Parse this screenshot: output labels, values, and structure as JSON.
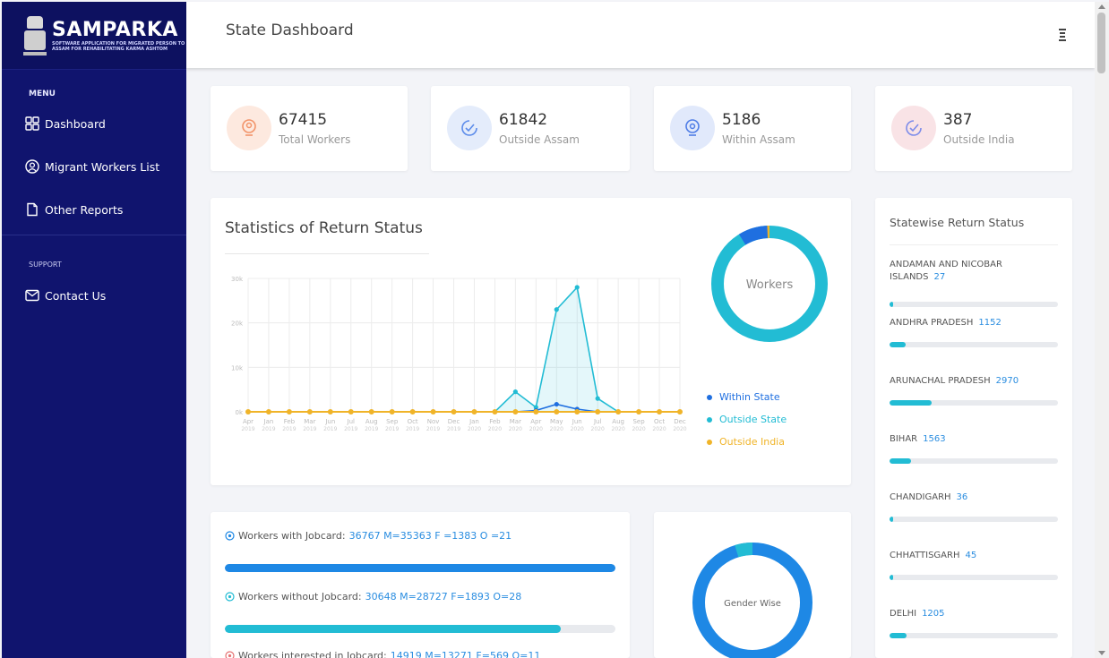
{
  "sidebar": {
    "brand_name": "SAMPARKA",
    "brand_sub": "SOFTWARE APPLICATION FOR MIGRATED PERSON TO ASSAM FOR REHABILITATING KARMA ASHTOM",
    "menu_heading": "MENU",
    "items": [
      {
        "label": "Dashboard",
        "icon": "dashboard-grid-icon"
      },
      {
        "label": "Migrant Workers List",
        "icon": "person-circle-icon"
      },
      {
        "label": "Other Reports",
        "icon": "document-icon"
      }
    ],
    "support_heading": "SUPPORT",
    "support_items": [
      {
        "label": "Contact Us",
        "icon": "mail-icon"
      }
    ]
  },
  "header": {
    "title": "State Dashboard"
  },
  "stats": [
    {
      "value": "67415",
      "label": "Total Workers",
      "icon": "person-pin-icon",
      "bg": "#fde9df",
      "fg": "#f2946a"
    },
    {
      "value": "61842",
      "label": "Outside Assam",
      "icon": "check-shield-icon",
      "bg": "#e4ecfb",
      "fg": "#5b8bea"
    },
    {
      "value": "5186",
      "label": "Within Assam",
      "icon": "location-pin-icon",
      "bg": "#e1e9fb",
      "fg": "#4f7de6"
    },
    {
      "value": "387",
      "label": "Outside India",
      "icon": "check-shield-icon",
      "bg": "#f9e3e6",
      "fg": "#7c8bea"
    }
  ],
  "return_status": {
    "title": "Statistics of Return Status",
    "donut_label": "Workers",
    "legend": [
      {
        "label": "Within State",
        "color": "#1f6fe0"
      },
      {
        "label": "Outside State",
        "color": "#22bcd4"
      },
      {
        "label": "Outside India",
        "color": "#f0b429"
      }
    ]
  },
  "chart_data": {
    "type": "line",
    "y_ticks": [
      "30k",
      "20k",
      "10k",
      "0k"
    ],
    "ylim": [
      0,
      30000
    ],
    "x": [
      "Apr 2019",
      "Jan 2019",
      "Feb 2019",
      "Mar 2019",
      "Jun 2019",
      "Jul 2019",
      "Aug 2019",
      "Sep 2019",
      "Oct 2019",
      "Nov 2019",
      "Dec 2019",
      "Jan 2020",
      "Feb 2020",
      "Mar 2020",
      "Apr 2020",
      "May 2020",
      "Jun 2020",
      "Jul 2020",
      "Aug 2020",
      "Sep 2020",
      "Oct 2020",
      "Dec 2020"
    ],
    "series": [
      {
        "name": "Within State",
        "color": "#1f6fe0",
        "values": [
          0,
          0,
          0,
          0,
          0,
          0,
          0,
          0,
          0,
          0,
          0,
          0,
          0,
          0,
          300,
          1700,
          600,
          0,
          0,
          0,
          0,
          0
        ]
      },
      {
        "name": "Outside State",
        "color": "#22bcd4",
        "values": [
          0,
          0,
          0,
          0,
          0,
          0,
          0,
          0,
          0,
          0,
          0,
          0,
          0,
          4500,
          1000,
          23000,
          28000,
          3000,
          0,
          0,
          0,
          0
        ]
      },
      {
        "name": "Outside India",
        "color": "#f0b429",
        "values": [
          0,
          0,
          0,
          0,
          0,
          0,
          0,
          0,
          0,
          0,
          0,
          0,
          0,
          0,
          0,
          0,
          0,
          0,
          0,
          0,
          0,
          0
        ]
      }
    ]
  },
  "statewise": {
    "title": "Statewise Return Status",
    "max": 12000,
    "rows": [
      {
        "name": "ANDAMAN AND NICOBAR ISLANDS",
        "value": "27",
        "n": 27
      },
      {
        "name": "ANDHRA PRADESH",
        "value": "1152",
        "n": 1152
      },
      {
        "name": "ARUNACHAL PRADESH",
        "value": "2970",
        "n": 2970
      },
      {
        "name": "BIHAR",
        "value": "1563",
        "n": 1563
      },
      {
        "name": "CHANDIGARH",
        "value": "36",
        "n": 36
      },
      {
        "name": "CHHATTISGARH",
        "value": "45",
        "n": 45
      },
      {
        "name": "DELHI",
        "value": "1205",
        "n": 1205
      }
    ]
  },
  "jobcard": {
    "with_label": "Workers with Jobcard:",
    "with_value": "36767 M=35363 F =1383 O =21",
    "with_fill": 1.0,
    "with_color": "#1e88e5",
    "without_label": "Workers without Jobcard:",
    "without_value": "30648 M=28727 F=1893 O=28",
    "without_fill": 0.86,
    "without_color": "#22bcd4",
    "interested_label": "Workers interested in Jobcard:",
    "interested_value": "14919 M=13271 F=569 O=11"
  },
  "gender": {
    "label": "Gender Wise"
  }
}
